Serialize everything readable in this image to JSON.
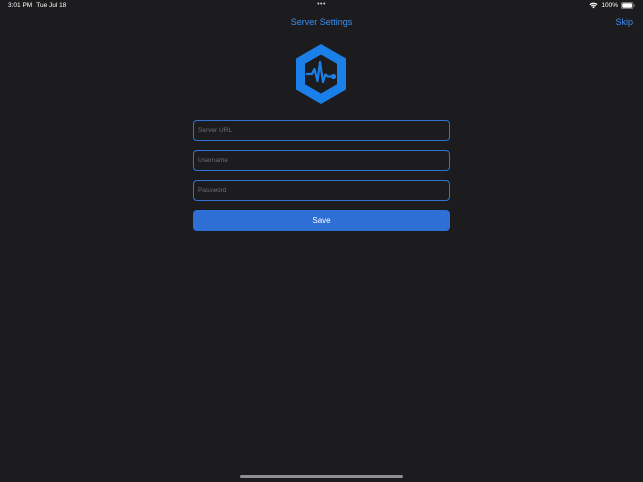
{
  "status_bar": {
    "time": "3:01 PM",
    "date": "Tue Jul 18",
    "dots": "•••",
    "battery": "100%"
  },
  "nav": {
    "title": "Server Settings",
    "skip_label": "Skip"
  },
  "form": {
    "server_url_placeholder": "Server URL",
    "username_placeholder": "Username",
    "password_placeholder": "Password",
    "save_label": "Save"
  },
  "colors": {
    "background": "#1c1c1e",
    "accent": "#3a8ef6",
    "button": "#2e6fd6",
    "logo": "#1a7fe8"
  },
  "icons": {
    "logo": "hexagon-pulse-icon",
    "wifi": "wifi-icon",
    "battery": "battery-icon"
  }
}
